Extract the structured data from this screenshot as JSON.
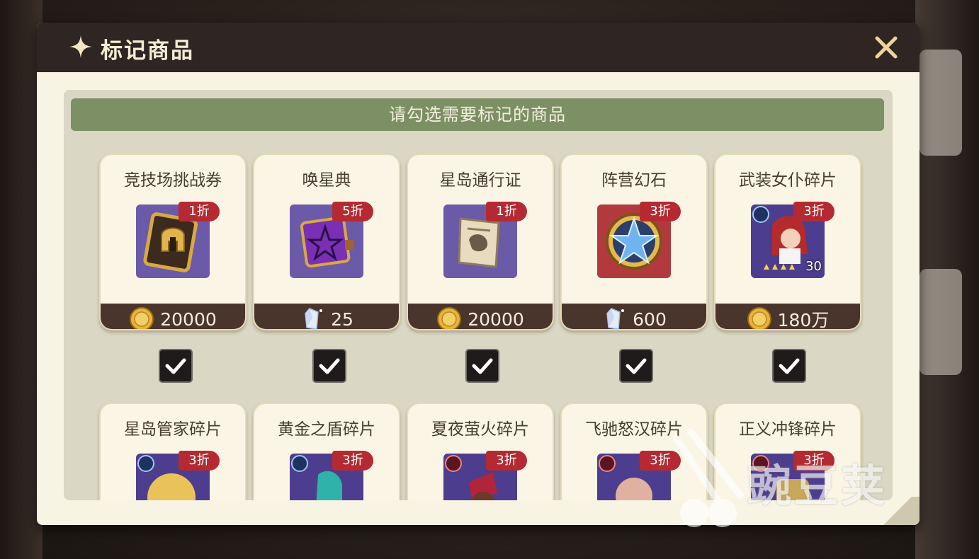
{
  "dialog": {
    "title": "标记商品",
    "banner": "请勾选需要标记的商品"
  },
  "row1": [
    {
      "name": "竞技场挑战券",
      "discount": "1折",
      "price": "20000",
      "currency": "gold-coin-icon",
      "checked": true,
      "icon": "golden-helmet-ticket-icon"
    },
    {
      "name": "唤星典",
      "discount": "5折",
      "price": "25",
      "currency": "crystal-icon",
      "checked": true,
      "icon": "purple-spellbook-icon"
    },
    {
      "name": "星岛通行证",
      "discount": "1折",
      "price": "20000",
      "currency": "gold-coin-icon",
      "checked": true,
      "icon": "parchment-pass-icon"
    },
    {
      "name": "阵营幻石",
      "discount": "3折",
      "price": "600",
      "currency": "crystal-icon",
      "checked": true,
      "icon": "star-medallion-icon"
    },
    {
      "name": "武装女仆碎片",
      "discount": "3折",
      "price": "180万",
      "currency": "gold-coin-icon",
      "checked": true,
      "icon": "maid-hero-portrait",
      "stars": "30"
    }
  ],
  "row2": [
    {
      "name": "星岛管家碎片",
      "discount": "3折"
    },
    {
      "name": "黄金之盾碎片",
      "discount": "3折"
    },
    {
      "name": "夏夜萤火碎片",
      "discount": "3折"
    },
    {
      "name": "飞驰怒汉碎片",
      "discount": "3折"
    },
    {
      "name": "正义冲锋碎片",
      "discount": "3折"
    }
  ],
  "watermark": "豌豆荚",
  "colors": {
    "titlebar": "#2f2523",
    "banner": "#7d8f64",
    "discount": "#b52a32",
    "price_bar": "#4a352c",
    "icon_bg": "#6b5aa8"
  }
}
